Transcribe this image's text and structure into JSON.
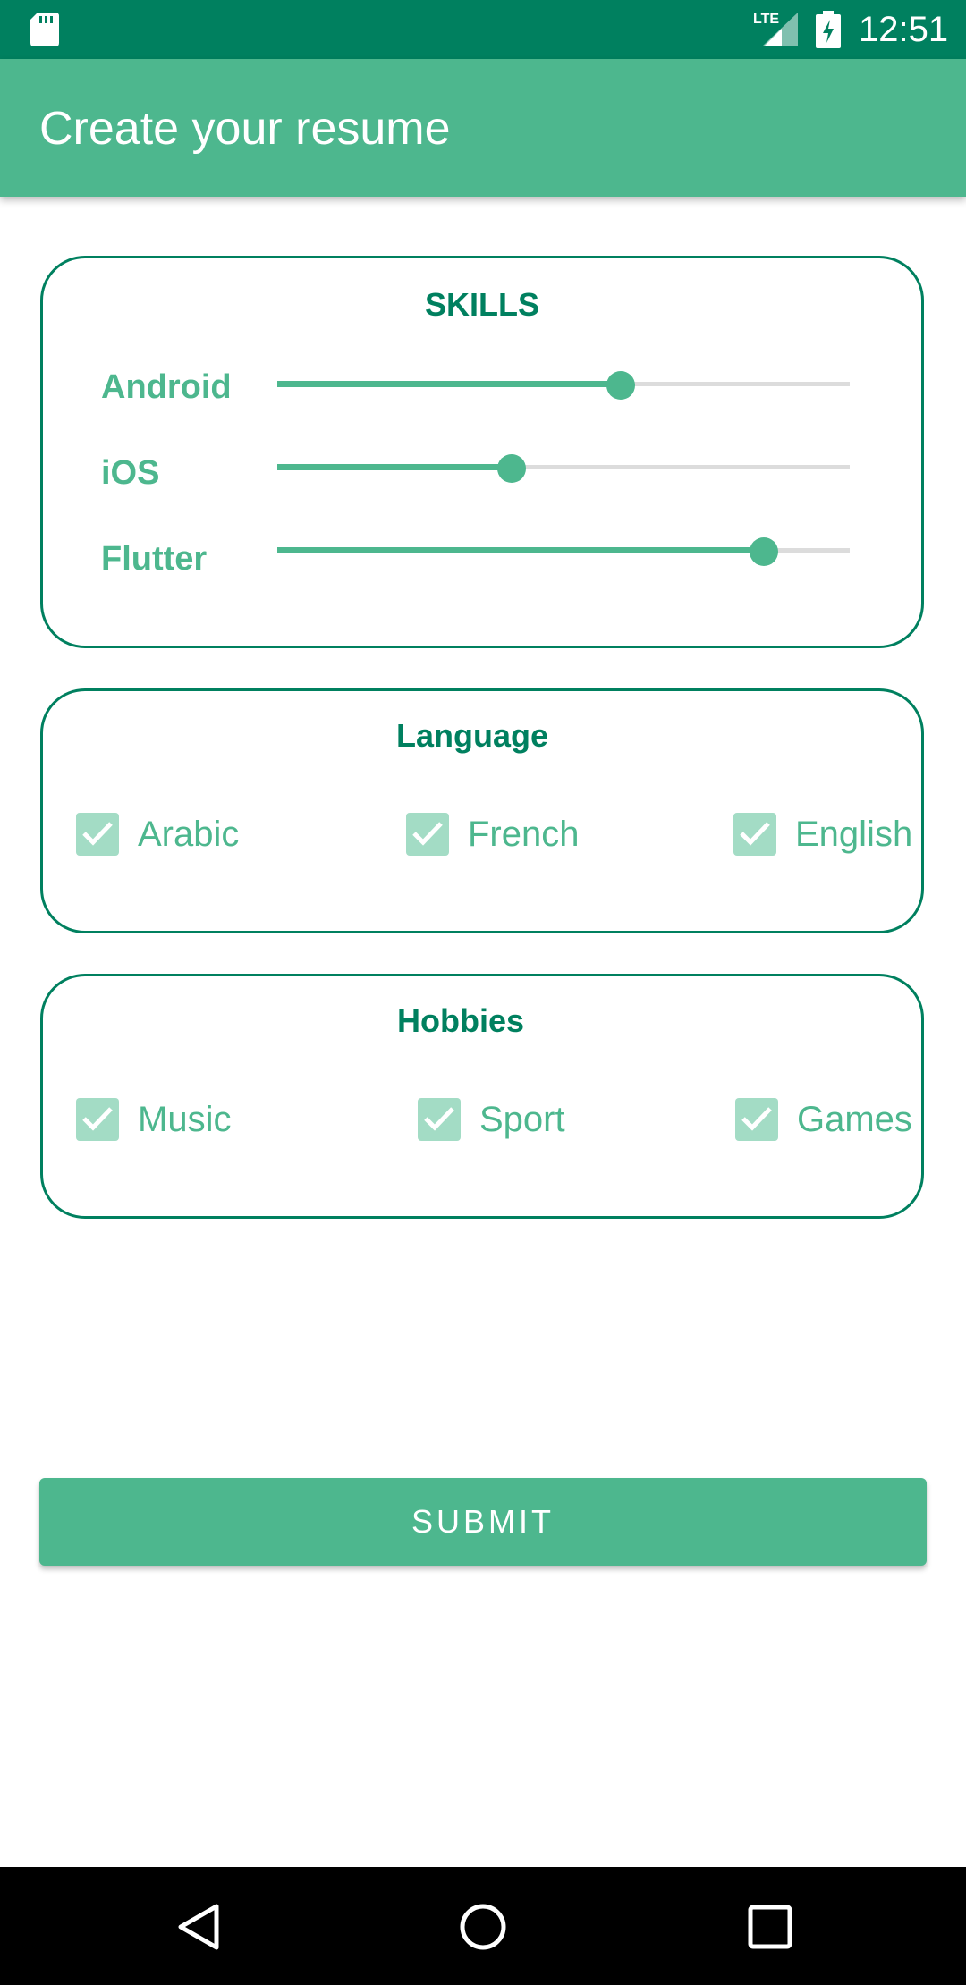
{
  "status_bar": {
    "time": "12:51",
    "network": "LTE",
    "icons": [
      "sd-card-icon",
      "signal-icon",
      "battery-charging-icon"
    ]
  },
  "app_bar": {
    "title": "Create your resume"
  },
  "skills": {
    "title": "SKILLS",
    "items": [
      {
        "label": "Android",
        "value": 0.6
      },
      {
        "label": "iOS",
        "value": 0.41
      },
      {
        "label": "Flutter",
        "value": 0.85
      }
    ]
  },
  "language": {
    "title": "Language",
    "items": [
      {
        "label": "Arabic",
        "checked": true
      },
      {
        "label": "French",
        "checked": true
      },
      {
        "label": "English",
        "checked": true
      }
    ]
  },
  "hobbies": {
    "title": "Hobbies",
    "items": [
      {
        "label": "Music",
        "checked": true
      },
      {
        "label": "Sport",
        "checked": true
      },
      {
        "label": "Games",
        "checked": true
      }
    ]
  },
  "submit_label": "SUBMIT",
  "colors": {
    "primary_dark": "#00805f",
    "primary": "#4db78e",
    "checkbox": "#a3dcc5"
  },
  "nav_bar": {
    "icons": [
      "back-icon",
      "home-icon",
      "recents-icon"
    ]
  }
}
